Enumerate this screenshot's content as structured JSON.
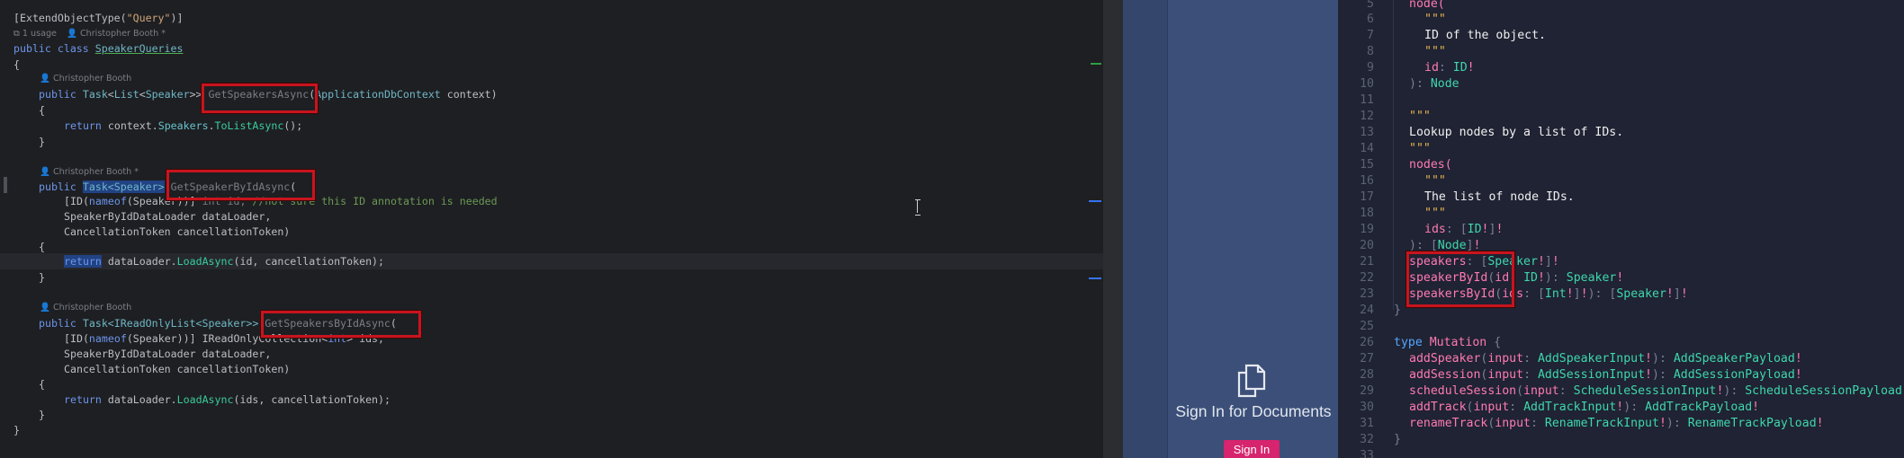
{
  "left_editor": {
    "hints": {
      "usage": "1 usage",
      "author_class": "Christopher Booth *",
      "author_m1": "Christopher Booth",
      "author_m2": "Christopher Booth *",
      "author_m3": "Christopher Booth"
    },
    "lines": {
      "attr_open": "[ExtendObjectType(",
      "attr_str": "\"Query\"",
      "attr_close": ")]",
      "class_kw": "public class ",
      "class_name": "SpeakerQueries",
      "brace_open": "{",
      "m1_pub": "public ",
      "m1_task": "Task",
      "m1_lt": "<",
      "m1_list": "List",
      "m1_lt2": "<",
      "m1_speaker": "Speaker",
      "m1_gt": ">> ",
      "m1_name": "GetSpeakersAsync",
      "m1_par": "(",
      "m1_ctx_type": "ApplicationDbContext",
      "m1_ctx": " context)",
      "m1_body_ret": "return ",
      "m1_body_ctx": "context.",
      "m1_body_prop": "Speakers",
      "m1_body_dot": ".",
      "m1_body_fn": "ToListAsync",
      "m1_body_end": "();",
      "m2_pub": "public ",
      "m2_task": "Task<Speaker>",
      "m2_name": "GetSpeakerByIdAsync",
      "m2_par": "(",
      "m2_a1_open": "[ID(",
      "m2_a1_nameof": "nameof",
      "m2_a1_mid": "(Speaker))] ",
      "m2_a1_int": "int id, ",
      "m2_a1_cmt": "//not sure this ID annotation is needed",
      "m2_a2": "SpeakerByIdDataLoader dataLoader,",
      "m2_a3": "CancellationToken cancellationToken)",
      "m2_ret": "return",
      "m2_body": " dataLoader.",
      "m2_fn": "LoadAsync",
      "m2_body_end": "(id, cancellationToken);",
      "m3_pub": "public ",
      "m3_task": "Task<IReadOnlyList<Speaker>> ",
      "m3_name": "GetSpeakersByIdAsync",
      "m3_par": "(",
      "m3_a1_open": "[ID(",
      "m3_a1_nameof": "nameof",
      "m3_a1_mid": "(Speaker))] IReadOnlyCollection<",
      "m3_a1_int": "int",
      "m3_a1_end": "> ids,",
      "m3_a2": "SpeakerByIdDataLoader dataLoader,",
      "m3_a3": "CancellationToken cancellationToken)",
      "m3_ret": "return ",
      "m3_body": "dataLoader.",
      "m3_fn": "LoadAsync",
      "m3_body_end": "(ids, cancellationToken);",
      "brace_close": "}",
      "brace_o": "{",
      "brace_c": "}"
    }
  },
  "docs_panel": {
    "title": "Sign In for Documents",
    "button_label": "Sign In",
    "icon": "documents-copy-icon"
  },
  "gql_editor": {
    "line_numbers": [
      "5",
      "6",
      "7",
      "8",
      "9",
      "10",
      "11",
      "12",
      "13",
      "14",
      "15",
      "16",
      "17",
      "18",
      "19",
      "20",
      "21",
      "22",
      "23",
      "24",
      "25",
      "26",
      "27",
      "28",
      "29",
      "30",
      "31",
      "32",
      "33"
    ],
    "lines": {
      "l5": "node(",
      "l6": "\"\"\"",
      "l7": "ID of the object.",
      "l8": "\"\"\"",
      "l9_f": "id",
      "l9_t": "ID",
      "l10_t": "Node",
      "l12": "\"\"\"",
      "l13": "Lookup nodes by a list of IDs.",
      "l14": "\"\"\"",
      "l15": "nodes(",
      "l16": "\"\"\"",
      "l17": "The list of node IDs.",
      "l18": "\"\"\"",
      "l19_f": "ids",
      "l19_t": "ID",
      "l20_t": "Node",
      "l21_f": "speakers",
      "l21_t": "Speaker",
      "l22_f": "speakerById",
      "l22_a": "id",
      "l22_at": "ID",
      "l22_t": "Speaker",
      "l23_f": "speakersById",
      "l23_a": "ids",
      "l23_at": "Int",
      "l23_t": "Speaker",
      "l26_kw": "type",
      "l26_n": "Mutation",
      "l27_f": "addSpeaker",
      "l27_a": "input",
      "l27_at": "AddSpeakerInput",
      "l27_t": "AddSpeakerPayload",
      "l28_f": "addSession",
      "l28_a": "input",
      "l28_at": "AddSessionInput",
      "l28_t": "AddSessionPayload",
      "l29_f": "scheduleSession",
      "l29_a": "input",
      "l29_at": "ScheduleSessionInput",
      "l29_t": "ScheduleSessionPayload",
      "l30_f": "addTrack",
      "l30_a": "input",
      "l30_at": "AddTrackInput",
      "l30_t": "AddTrackPayload",
      "l31_f": "renameTrack",
      "l31_a": "input",
      "l31_at": "RenameTrackInput",
      "l31_t": "RenameTrackPayload"
    }
  },
  "colors": {
    "highlight_box": "#c8141e",
    "signin_button": "#d6246e",
    "docs_panel_bg": "#3b4f78"
  }
}
